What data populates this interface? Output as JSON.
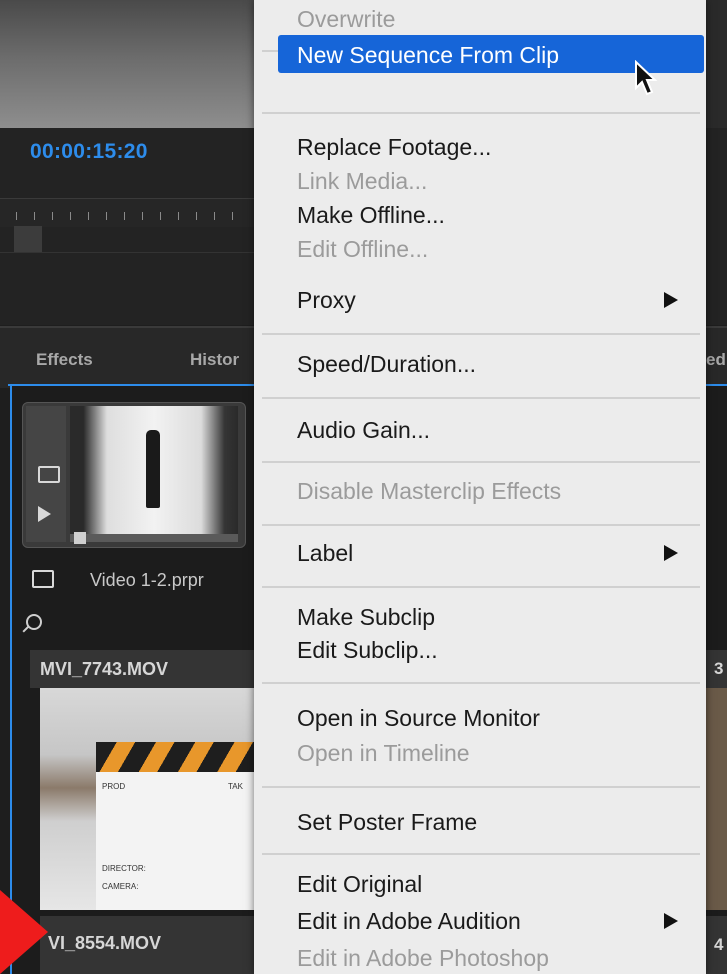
{
  "source_monitor": {
    "timecode": "00:00:15:20"
  },
  "panel_tabs": [
    "Effects",
    "Histor",
    "edi"
  ],
  "project": {
    "bin_label": "Video 1-2.prpr",
    "clips": [
      {
        "name": "MVI_7743.MOV",
        "right_num": "3"
      },
      {
        "name": "VI_8554.MOV",
        "right_num": "4"
      }
    ],
    "slate_text": {
      "prod": "PROD",
      "take": "TAK",
      "director": "DIRECTOR:",
      "camera": "CAMERA:"
    }
  },
  "menu": {
    "items": [
      {
        "label": "Overwrite",
        "enabled": false
      },
      {
        "label": "New Sequence From Clip",
        "enabled": true,
        "highlighted": true
      },
      {
        "label": "Replace Footage...",
        "enabled": true
      },
      {
        "label": "Link Media...",
        "enabled": false
      },
      {
        "label": "Make Offline...",
        "enabled": true
      },
      {
        "label": "Edit Offline...",
        "enabled": false
      },
      {
        "label": "Proxy",
        "enabled": true,
        "submenu": true
      },
      {
        "label": "Speed/Duration...",
        "enabled": true
      },
      {
        "label": "Audio Gain...",
        "enabled": true
      },
      {
        "label": "Disable Masterclip Effects",
        "enabled": false
      },
      {
        "label": "Label",
        "enabled": true,
        "submenu": true
      },
      {
        "label": "Make Subclip",
        "enabled": true
      },
      {
        "label": "Edit Subclip...",
        "enabled": true
      },
      {
        "label": "Open in Source Monitor",
        "enabled": true
      },
      {
        "label": "Open in Timeline",
        "enabled": false
      },
      {
        "label": "Set Poster Frame",
        "enabled": true
      },
      {
        "label": "Edit Original",
        "enabled": true
      },
      {
        "label": "Edit in Adobe Audition",
        "enabled": true,
        "submenu": true
      },
      {
        "label": "Edit in Adobe Photoshop",
        "enabled": false
      }
    ]
  },
  "colors": {
    "accent_blue": "#2d8ceb",
    "menu_highlight": "#1665d8",
    "annotation_red": "#ee1c1c"
  }
}
